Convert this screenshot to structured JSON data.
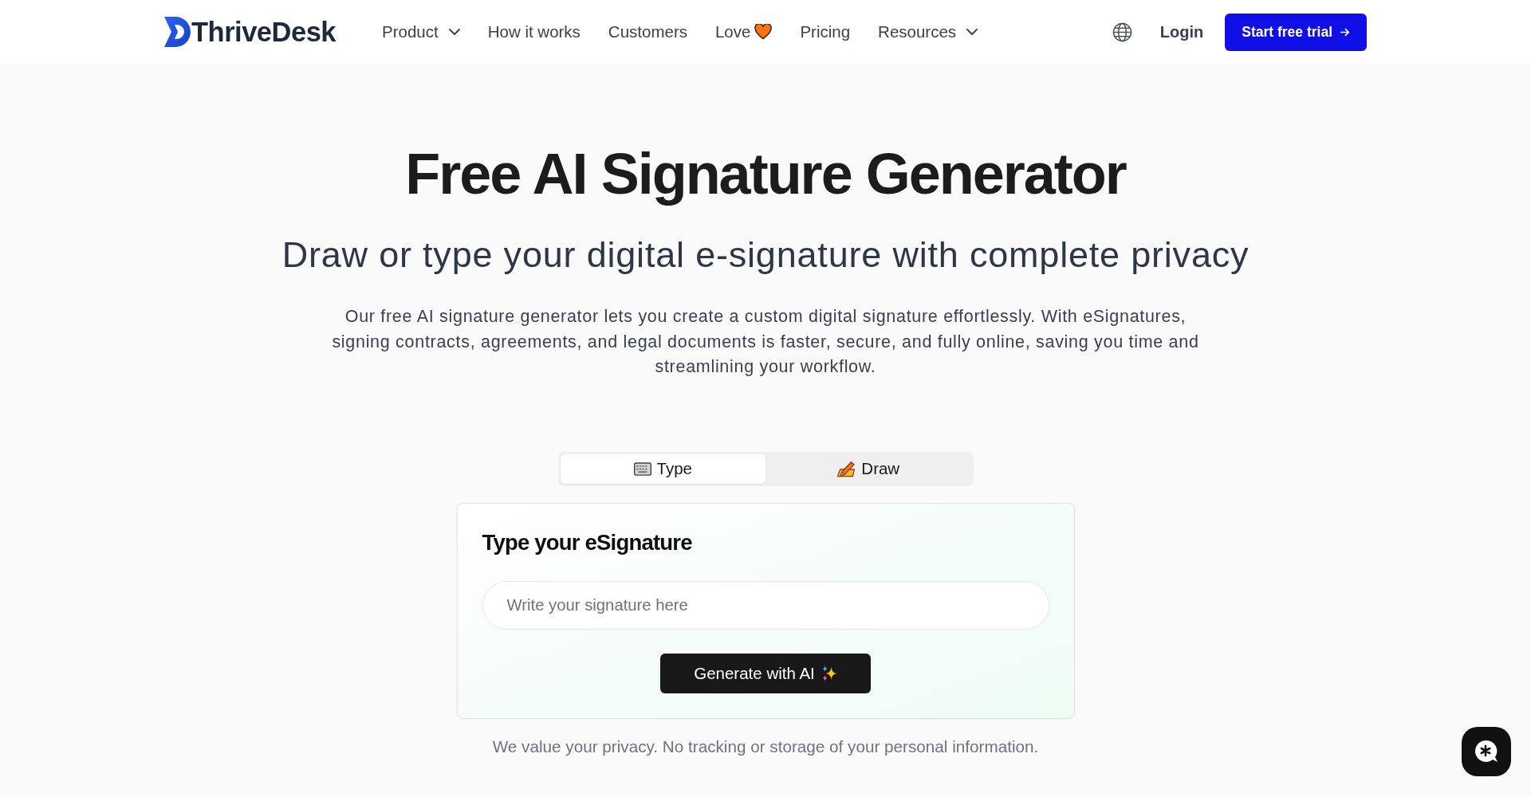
{
  "header": {
    "logo": "ThriveDesk",
    "nav": [
      {
        "label": "Product",
        "kind": "dropdown"
      },
      {
        "label": "How it works",
        "kind": "link"
      },
      {
        "label": "Customers",
        "kind": "link"
      },
      {
        "label": "Love",
        "kind": "favorite"
      },
      {
        "label": "Pricing",
        "kind": "link"
      },
      {
        "label": "Resources",
        "kind": "dropdown"
      }
    ],
    "login": "Login",
    "cta": "Start free trial"
  },
  "hero": {
    "title": "Free AI Signature Generator",
    "subtitle": "Draw or type your digital e-signature with complete privacy",
    "description": "Our free AI signature generator lets you create a custom digital signature effortlessly. With eSignatures, signing contracts, agreements, and legal documents is faster, secure, and fully online, saving you time and streamlining your workflow."
  },
  "tabs": [
    {
      "label": "Type",
      "kind": "typing",
      "selected": true
    },
    {
      "label": "Draw",
      "kind": "drawing",
      "selected": false
    }
  ],
  "card": {
    "title": "Type your eSignature",
    "input": {
      "placeholder": "Write your signature here"
    },
    "button": "Generate with AI"
  },
  "privacy_note": "We value your privacy. No tracking or storage of your personal information."
}
